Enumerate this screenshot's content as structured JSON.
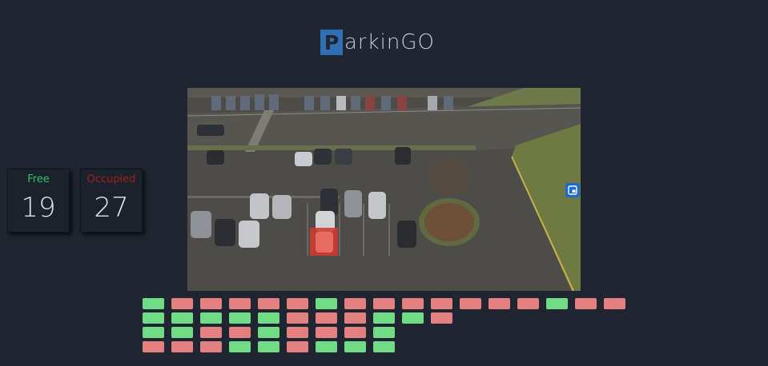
{
  "brand": {
    "logo_letter": "P",
    "logo_rest": "arkinGO",
    "accent": "#2f6fb2"
  },
  "stats": {
    "free_label": "Free",
    "free_value": "19",
    "occupied_label": "Occupied",
    "occupied_value": "27",
    "free_color": "#30c46a",
    "occupied_color": "#a11f1f"
  },
  "camera": {
    "pip_icon": "picture-in-picture-icon",
    "highlighted_car": "red-highlight"
  },
  "slot_colors": {
    "free": "#71dc85",
    "occupied": "#e48080"
  },
  "slots": [
    [
      "free",
      "occupied",
      "occupied",
      "occupied",
      "occupied",
      "occupied",
      "free",
      "occupied",
      "occupied",
      "occupied",
      "occupied",
      "occupied",
      "occupied",
      "occupied",
      "free",
      "occupied",
      "occupied"
    ],
    [
      "free",
      "free",
      "free",
      "free",
      "free",
      "occupied",
      "occupied",
      "occupied",
      "free",
      "free",
      "occupied"
    ],
    [
      "free",
      "free",
      "occupied",
      "occupied",
      "free",
      "occupied",
      "occupied",
      "occupied",
      "free"
    ],
    [
      "occupied",
      "occupied",
      "occupied",
      "free",
      "free",
      "occupied",
      "free",
      "free",
      "free"
    ]
  ]
}
